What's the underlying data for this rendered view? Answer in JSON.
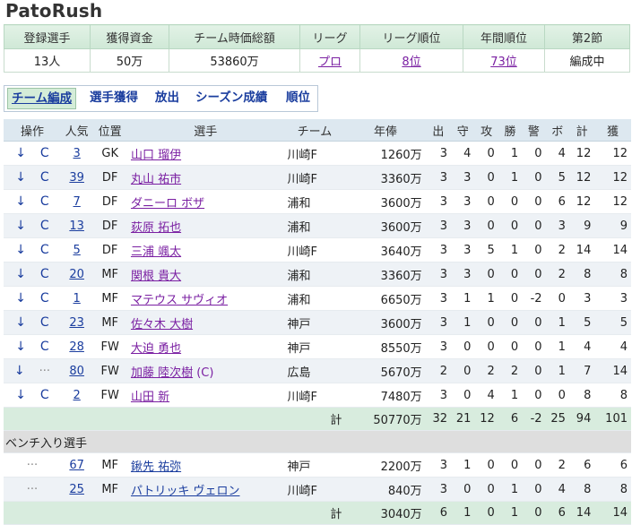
{
  "app_title": "PatoRush",
  "summary": {
    "headers": [
      "登録選手",
      "獲得資金",
      "チーム時価総額",
      "リーグ",
      "リーグ順位",
      "年間順位",
      "第2節"
    ],
    "values": {
      "players": "13人",
      "funds": "50万",
      "market_value": "53860万",
      "league": "プロ",
      "league_rank": "8位",
      "annual_rank": "73位",
      "status": "編成中"
    }
  },
  "nav": {
    "tabs": [
      "チーム編成",
      "選手獲得",
      "放出",
      "シーズン成績",
      "順位"
    ],
    "active": "チーム編成"
  },
  "roster": {
    "headers": [
      "操作",
      "人気",
      "位置",
      "選手",
      "チーム",
      "年俸",
      "出",
      "守",
      "攻",
      "勝",
      "警",
      "ボ",
      "計",
      "獲"
    ],
    "starters": [
      {
        "act1": "↓",
        "act2": "C",
        "pop": "3",
        "pos": "GK",
        "name": "山口 瑠伊",
        "team": "川崎F",
        "salary": "1260万",
        "s1": "3",
        "s2": "4",
        "s3": "0",
        "s4": "1",
        "s5": "0",
        "s6": "4",
        "s7": "12",
        "s8": "12"
      },
      {
        "act1": "↓",
        "act2": "C",
        "pop": "39",
        "pos": "DF",
        "name": "丸山 祐市",
        "team": "川崎F",
        "salary": "3360万",
        "s1": "3",
        "s2": "3",
        "s3": "0",
        "s4": "1",
        "s5": "0",
        "s6": "5",
        "s7": "12",
        "s8": "12"
      },
      {
        "act1": "↓",
        "act2": "C",
        "pop": "7",
        "pos": "DF",
        "name": "ダニーロ ボザ",
        "team": "浦和",
        "salary": "3600万",
        "s1": "3",
        "s2": "3",
        "s3": "0",
        "s4": "0",
        "s5": "0",
        "s6": "6",
        "s7": "12",
        "s8": "12"
      },
      {
        "act1": "↓",
        "act2": "C",
        "pop": "13",
        "pos": "DF",
        "name": "荻原 拓也",
        "team": "浦和",
        "salary": "3600万",
        "s1": "3",
        "s2": "3",
        "s3": "0",
        "s4": "0",
        "s5": "0",
        "s6": "3",
        "s7": "9",
        "s8": "9"
      },
      {
        "act1": "↓",
        "act2": "C",
        "pop": "5",
        "pos": "DF",
        "name": "三浦 颯太",
        "team": "川崎F",
        "salary": "3640万",
        "s1": "3",
        "s2": "3",
        "s3": "5",
        "s4": "1",
        "s5": "0",
        "s6": "2",
        "s7": "14",
        "s8": "14"
      },
      {
        "act1": "↓",
        "act2": "C",
        "pop": "20",
        "pos": "MF",
        "name": "関根 貴大",
        "team": "浦和",
        "salary": "3360万",
        "s1": "3",
        "s2": "3",
        "s3": "0",
        "s4": "0",
        "s5": "0",
        "s6": "2",
        "s7": "8",
        "s8": "8"
      },
      {
        "act1": "↓",
        "act2": "C",
        "pop": "1",
        "pos": "MF",
        "name": "マテウス サヴィオ",
        "team": "浦和",
        "salary": "6650万",
        "s1": "3",
        "s2": "1",
        "s3": "1",
        "s4": "0",
        "s5": "-2",
        "s6": "0",
        "s7": "3",
        "s8": "3"
      },
      {
        "act1": "↓",
        "act2": "C",
        "pop": "23",
        "pos": "MF",
        "name": "佐々木 大樹",
        "team": "神戸",
        "salary": "3600万",
        "s1": "3",
        "s2": "1",
        "s3": "0",
        "s4": "0",
        "s5": "0",
        "s6": "1",
        "s7": "5",
        "s8": "5"
      },
      {
        "act1": "↓",
        "act2": "C",
        "pop": "28",
        "pos": "FW",
        "name": "大迫 勇也",
        "team": "神戸",
        "salary": "8550万",
        "s1": "3",
        "s2": "0",
        "s3": "0",
        "s4": "0",
        "s5": "0",
        "s6": "1",
        "s7": "4",
        "s8": "4"
      },
      {
        "act1": "↓",
        "act2": "···",
        "pop": "80",
        "pos": "FW",
        "name": "加藤 陸次樹",
        "captain": "(C)",
        "team": "広島",
        "salary": "5670万",
        "s1": "2",
        "s2": "0",
        "s3": "2",
        "s4": "2",
        "s5": "0",
        "s6": "1",
        "s7": "7",
        "s8": "14"
      },
      {
        "act1": "↓",
        "act2": "C",
        "pop": "2",
        "pos": "FW",
        "name": "山田 新",
        "team": "川崎F",
        "salary": "7480万",
        "s1": "3",
        "s2": "0",
        "s3": "4",
        "s4": "1",
        "s5": "0",
        "s6": "0",
        "s7": "8",
        "s8": "8"
      }
    ],
    "starters_total": {
      "label": "計",
      "salary": "50770万",
      "s1": "32",
      "s2": "21",
      "s3": "12",
      "s4": "6",
      "s5": "-2",
      "s6": "25",
      "s7": "94",
      "s8": "101"
    },
    "bench_title": "ベンチ入り選手",
    "bench": [
      {
        "act": "···",
        "pop": "67",
        "pos": "MF",
        "name": "鍬先 祐弥",
        "team": "神戸",
        "salary": "2200万",
        "s1": "3",
        "s2": "1",
        "s3": "0",
        "s4": "0",
        "s5": "0",
        "s6": "2",
        "s7": "6",
        "s8": "6"
      },
      {
        "act": "···",
        "pop": "25",
        "pos": "MF",
        "name": "パトリッキ ヴェロン",
        "team": "川崎F",
        "salary": "840万",
        "s1": "3",
        "s2": "0",
        "s3": "0",
        "s4": "1",
        "s5": "0",
        "s6": "4",
        "s7": "8",
        "s8": "8"
      }
    ],
    "bench_total": {
      "label": "計",
      "salary": "3040万",
      "s1": "6",
      "s2": "1",
      "s3": "0",
      "s4": "1",
      "s5": "0",
      "s6": "6",
      "s7": "14",
      "s8": "14"
    }
  }
}
